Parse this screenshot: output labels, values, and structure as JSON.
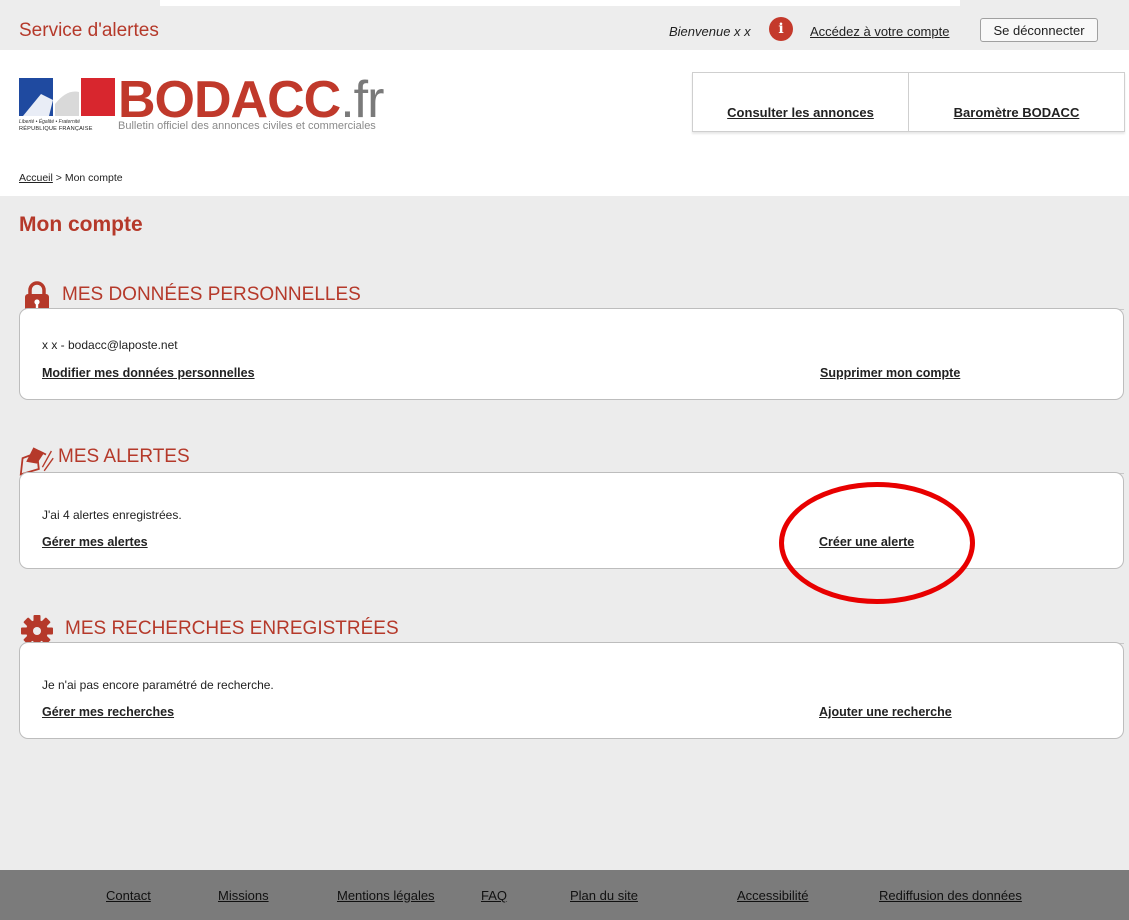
{
  "topbar": {
    "service_title": "Service d'alertes",
    "welcome": "Bienvenue x x",
    "info_icon": "info-icon",
    "account_link": "Accédez à votre compte",
    "logout_button": "Se déconnecter"
  },
  "logo": {
    "brand": "BODACC",
    "tld": ".fr",
    "tagline": "Bulletin officiel des annonces civiles et commerciales",
    "motto": "Liberté • Égalité • Fraternité",
    "republic": "RÉPUBLIQUE FRANÇAISE"
  },
  "nav": {
    "items": [
      {
        "label": "Consulter les annonces"
      },
      {
        "label": "Baromètre BODACC"
      }
    ]
  },
  "breadcrumb": {
    "home": "Accueil",
    "separator": ">",
    "current": "Mon compte"
  },
  "page": {
    "title": "Mon compte"
  },
  "sections": {
    "personal": {
      "icon": "lock-icon",
      "title": "MES DONNÉES PERSONNELLES",
      "text": "x x - bodacc@laposte.net",
      "left_link": "Modifier mes données personnelles",
      "right_link": "Supprimer mon compte"
    },
    "alerts": {
      "icon": "envelope-alert-icon",
      "title": "MES ALERTES",
      "text": "J'ai 4 alertes enregistrées.",
      "left_link": "Gérer mes alertes",
      "right_link": "Créer une alerte"
    },
    "searches": {
      "icon": "gear-icon",
      "title": "MES RECHERCHES ENREGISTRÉES",
      "text": "Je n'ai pas encore paramétré de recherche.",
      "left_link": "Gérer mes recherches",
      "right_link": "Ajouter une recherche"
    }
  },
  "footer": {
    "links": [
      "Contact",
      "Missions",
      "Mentions légales",
      "FAQ",
      "Plan du site",
      "Accessibilité",
      "Rediffusion des données"
    ]
  },
  "colors": {
    "accent": "#b5392a",
    "annotation": "#e80000",
    "main_bg": "#ececec",
    "footer_bg": "#7b7b7b"
  }
}
